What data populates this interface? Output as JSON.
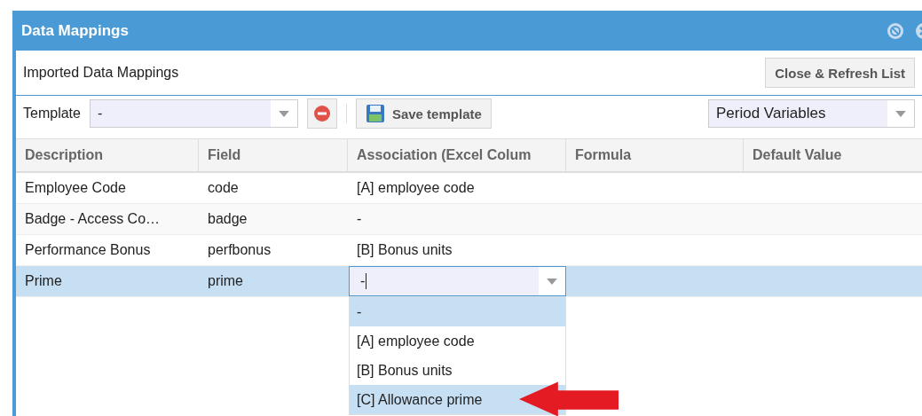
{
  "window": {
    "title": "Data Mappings"
  },
  "header": {
    "subtitle": "Imported Data Mappings",
    "close_button": "Close & Refresh List"
  },
  "toolbar": {
    "template_label": "Template",
    "template_value": "-",
    "save_button": "Save template",
    "period_value": "Period Variables"
  },
  "table": {
    "columns": [
      "Description",
      "Field",
      "Association (Excel Colum",
      "Formula",
      "Default Value"
    ],
    "rows": [
      {
        "description": "Employee Code",
        "field": "code",
        "association": "[A] employee code",
        "selected": false,
        "editing": false
      },
      {
        "description": "Badge - Access Co…",
        "field": "badge",
        "association": "-",
        "selected": false,
        "editing": false
      },
      {
        "description": "Performance Bonus",
        "field": "perfbonus",
        "association": "[B] Bonus units",
        "selected": false,
        "editing": false
      },
      {
        "description": "Prime",
        "field": "prime",
        "association": "-",
        "selected": true,
        "editing": true
      }
    ]
  },
  "dropdown": {
    "options": [
      {
        "label": "-",
        "highlighted": true
      },
      {
        "label": "[A] employee code",
        "highlighted": false
      },
      {
        "label": "[B] Bonus units",
        "highlighted": false
      },
      {
        "label": "[C] Allowance prime",
        "highlighted": true
      }
    ]
  }
}
